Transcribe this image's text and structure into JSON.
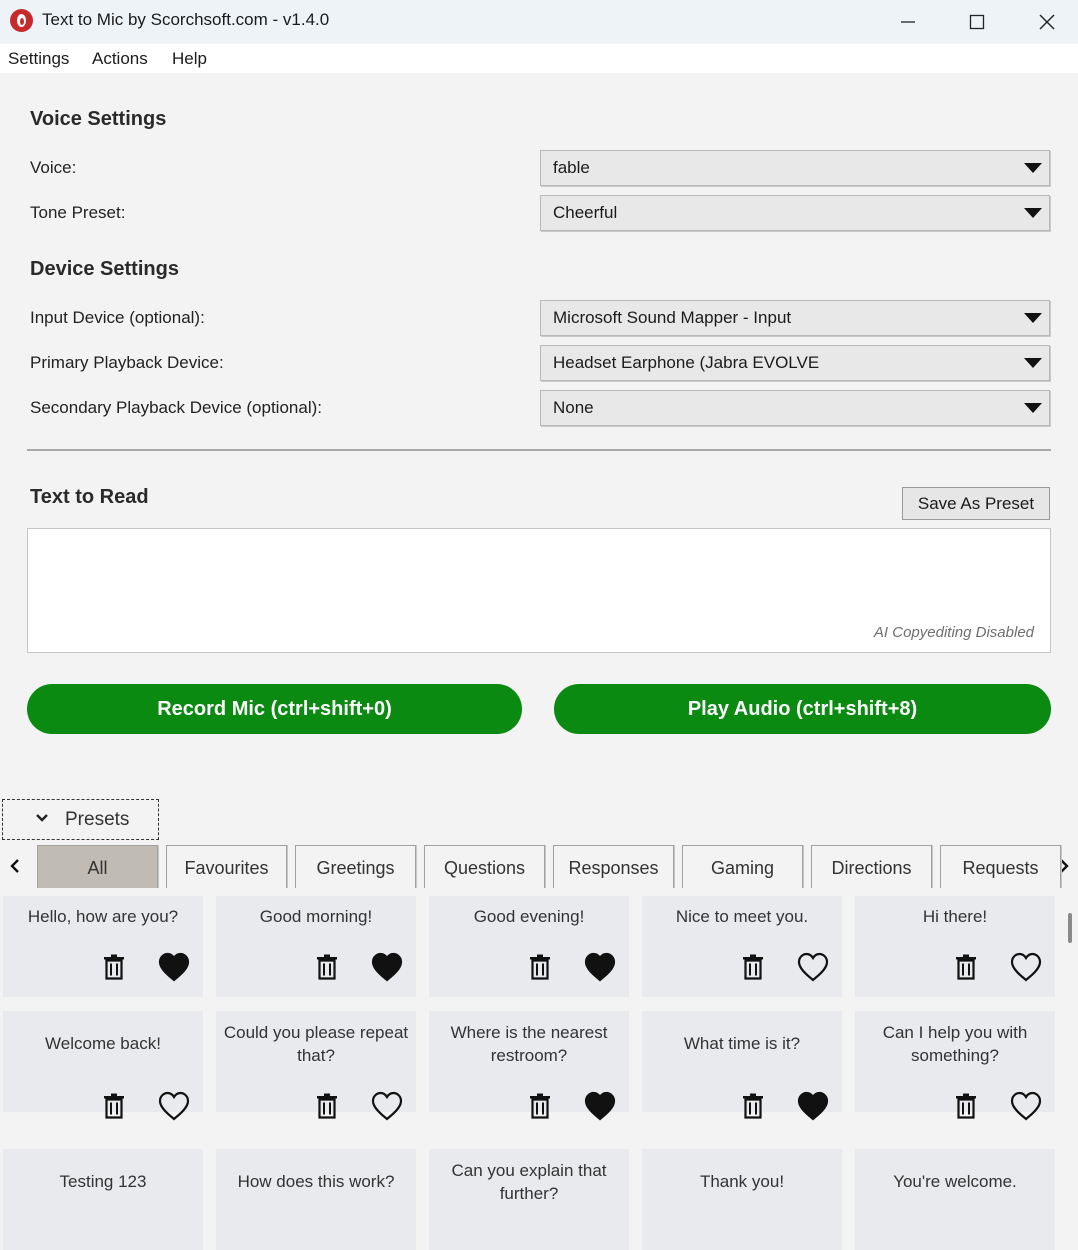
{
  "window": {
    "title": "Text to Mic by Scorchsoft.com - v1.4.0"
  },
  "menu": [
    "Settings",
    "Actions",
    "Help"
  ],
  "voice_settings": {
    "title": "Voice Settings",
    "voice_label": "Voice:",
    "voice_value": "fable",
    "tone_label": "Tone Preset:",
    "tone_value": "Cheerful"
  },
  "device_settings": {
    "title": "Device Settings",
    "input_label": "Input Device (optional):",
    "input_value": "Microsoft Sound Mapper - Input",
    "primary_label": "Primary Playback Device:",
    "primary_value": "Headset Earphone (Jabra EVOLVE",
    "secondary_label": "Secondary Playback Device (optional):",
    "secondary_value": "None"
  },
  "text_to_read": {
    "title": "Text to Read",
    "save_button": "Save As Preset",
    "value": "",
    "ai_note": "AI Copyediting Disabled"
  },
  "buttons": {
    "record": "Record Mic (ctrl+shift+0)",
    "play": "Play Audio (ctrl+shift+8)"
  },
  "presets": {
    "toggle_label": "Presets",
    "tabs": [
      "All",
      "Favourites",
      "Greetings",
      "Questions",
      "Responses",
      "Gaming",
      "Directions",
      "Requests"
    ],
    "active_tab": "All",
    "items": [
      {
        "text": "Hello, how are you?",
        "favourite": true
      },
      {
        "text": "Good morning!",
        "favourite": true
      },
      {
        "text": "Good evening!",
        "favourite": true
      },
      {
        "text": "Nice to meet you.",
        "favourite": false
      },
      {
        "text": "Hi there!",
        "favourite": false
      },
      {
        "text": "Welcome back!",
        "favourite": false
      },
      {
        "text": "Could you please repeat that?",
        "favourite": false
      },
      {
        "text": "Where is the nearest restroom?",
        "favourite": true
      },
      {
        "text": "What time is it?",
        "favourite": true
      },
      {
        "text": "Can I help you with something?",
        "favourite": false
      },
      {
        "text": "Testing 123",
        "favourite": false
      },
      {
        "text": "How does this work?",
        "favourite": false
      },
      {
        "text": "Can you explain that further?",
        "favourite": false
      },
      {
        "text": "Thank you!",
        "favourite": false
      },
      {
        "text": "You're welcome.",
        "favourite": false
      }
    ]
  }
}
